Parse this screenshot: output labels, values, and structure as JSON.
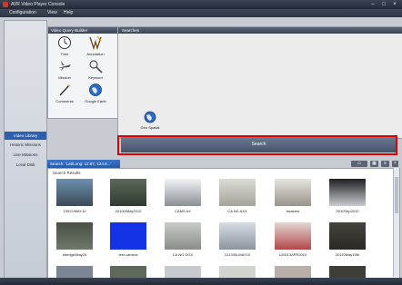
{
  "window": {
    "title": "AVR Video Player Console"
  },
  "menu": [
    "Configuration",
    "View",
    "Help"
  ],
  "nav": [
    {
      "label": "Video Library",
      "active": true
    },
    {
      "label": "Historic Missions",
      "active": false
    },
    {
      "label": "Live Missions",
      "active": false
    },
    {
      "label": "Local Disk",
      "active": false
    }
  ],
  "query_panel": {
    "header": "Video Query Builder",
    "buttons": [
      {
        "label": "Time",
        "icon": "clock-icon"
      },
      {
        "label": "Annotation",
        "icon": "annotation-icon"
      },
      {
        "label": "Mission",
        "icon": "mission-icon"
      },
      {
        "label": "Keyword",
        "icon": "keyword-icon"
      },
      {
        "label": "Comments",
        "icon": "comments-icon"
      },
      {
        "label": "Google Earth",
        "icon": "globe-icon"
      }
    ]
  },
  "search_area": {
    "header": "Searches",
    "query_item": "Geo Spatial",
    "search_button": "Search"
  },
  "results": {
    "tab": "Search: 'Lat/Long: 12.87, 124.8...'",
    "header": "Search Results",
    "thumbnails": [
      {
        "caption": "10022/MAY10",
        "colors": [
          "#6b8fb0",
          "#3c4a57"
        ]
      },
      {
        "caption": "20100/May2010",
        "colors": [
          "#5a6a58",
          "#2e3a30"
        ]
      },
      {
        "caption": "CAMS AX",
        "colors": [
          "#f2f4f6",
          "#8a8f95"
        ]
      },
      {
        "caption": "CA NG AXX",
        "colors": [
          "#dadcd6",
          "#a5a49a"
        ]
      },
      {
        "caption": "boatrest",
        "colors": [
          "#e6e4e0",
          "#9a9488"
        ]
      },
      {
        "caption": "0010Sep2010",
        "colors": [
          "#1e1f22",
          "#c8ccd0"
        ]
      },
      {
        "caption": "bitedge/May25",
        "colors": [
          "#4a5046",
          "#6e7768"
        ]
      },
      {
        "caption": "test camera",
        "colors": [
          "#1432e6",
          "#1432e6"
        ]
      },
      {
        "caption": "CA NG GGX",
        "colors": [
          "#c9cbc8",
          "#8a8d88"
        ]
      },
      {
        "caption": "121330LMAY10",
        "colors": [
          "#d8dde4",
          "#8b949e"
        ]
      },
      {
        "caption": "120013APR2010",
        "colors": [
          "#e2d8d6",
          "#b24848"
        ]
      },
      {
        "caption": "20110May15th",
        "colors": [
          "#45433d",
          "#2a2925"
        ]
      }
    ]
  }
}
